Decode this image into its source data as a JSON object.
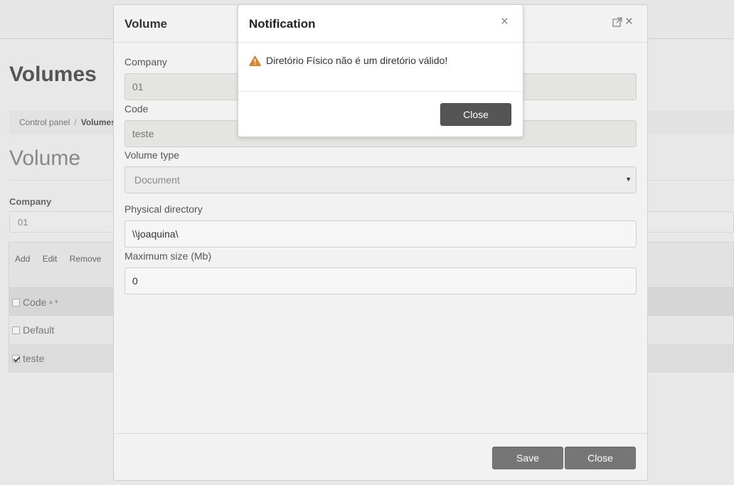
{
  "page": {
    "title": "Volumes",
    "breadcrumb": {
      "root": "Control panel",
      "separator": "/",
      "current": "Volumes"
    },
    "section_title": "Volume",
    "company_label": "Company",
    "company_value": "01",
    "grid": {
      "toolbar": [
        "Add",
        "Edit",
        "Remove"
      ],
      "column_code": "Code",
      "rows": [
        {
          "code": "Default",
          "checked": false
        },
        {
          "code": "teste",
          "checked": true
        }
      ]
    }
  },
  "volume_modal": {
    "title": "Volume",
    "fields": {
      "company": {
        "label": "Company",
        "value": "01"
      },
      "code": {
        "label": "Code",
        "value": "teste"
      },
      "volume_type": {
        "label": "Volume type",
        "value": "Document"
      },
      "physical_directory": {
        "label": "Physical directory",
        "value": "\\\\joaquina\\"
      },
      "maximum_size": {
        "label": "Maximum size (Mb)",
        "value": "0"
      }
    },
    "buttons": {
      "save": "Save",
      "close": "Close"
    }
  },
  "notification": {
    "title": "Notification",
    "message": "Diretório Físico não é um diretório válido!",
    "close_button": "Close",
    "warning_color": "#e8821e"
  },
  "icons": {
    "close": "×",
    "external": "external-link-icon",
    "warning": "warning-icon",
    "caret": "▼",
    "sort": "▲▼"
  }
}
